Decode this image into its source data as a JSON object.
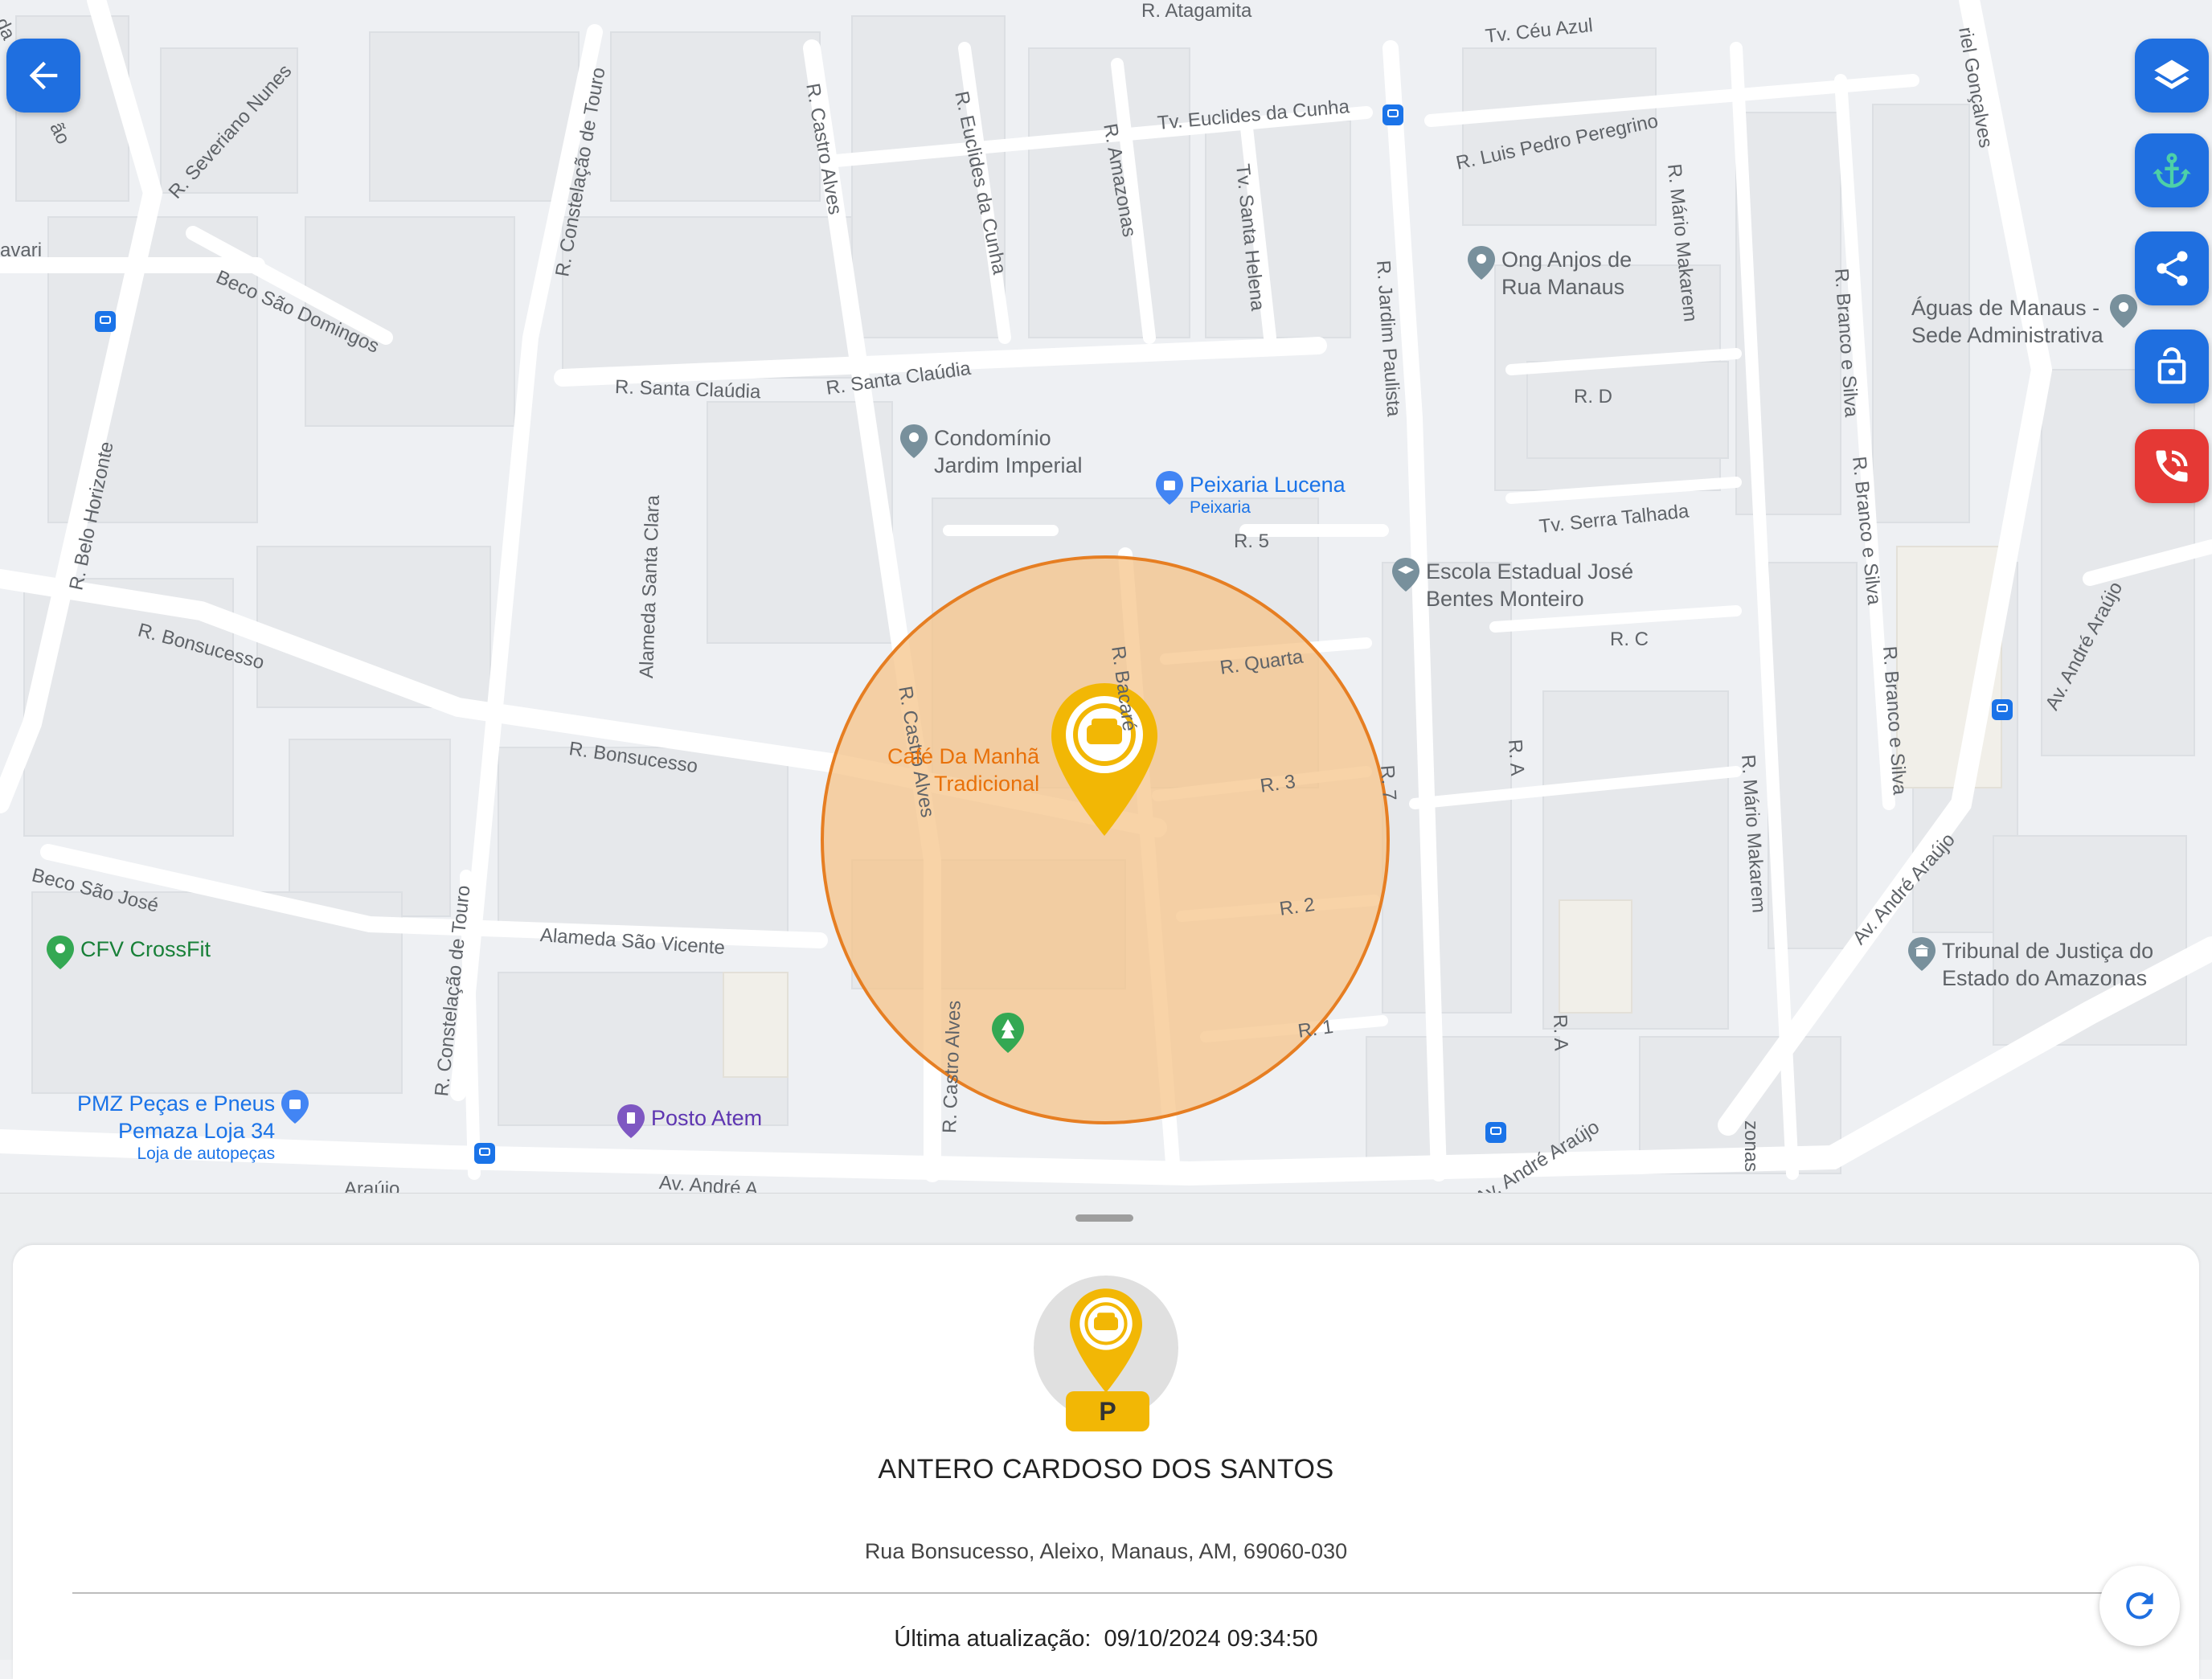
{
  "map": {
    "streets": [
      "R. Severiano Nunes",
      "R. Constelação de Touro",
      "R. Castro Alves",
      "R. Euclides da Cunha",
      "R. Amazonas",
      "Tv. Santa Helena",
      "R. Jardim Paulista",
      "R. Mário Makarem",
      "R. Branco e Silva",
      "Tv. Céu Azul",
      "Tv. Euclides da Cunha",
      "R. Luis Pedro Peregrino",
      "R. Atagamita",
      "Beco São Domingos",
      "R. Belo Horizonte",
      "R. Santa Claúdia",
      "R. Santa Claúdia",
      "Alameda Santa Clara",
      "R. Bonsucesso",
      "R. Bonsucesso",
      "Beco São José",
      "Alameda São Vicente",
      "R. 5",
      "Tv. Serra Talhada",
      "R. D",
      "R. C",
      "R. Quarta",
      "R. Bacaré",
      "R. 3",
      "R. 2",
      "R. 1",
      "R. 7",
      "R. A",
      "R. A",
      "Av. André Araújo",
      "Av. André Araújo",
      "Av. André Araújo",
      "Av. André Araújo",
      "Araújo",
      "Av. André A",
      "R. Castro Alves",
      "R. Castro Alves",
      "R. Constelação de Touro",
      "R. Mário Makarem",
      "R. Branco e Silva",
      "R. Branco e Silva",
      "zonas",
      "avari",
      "riel Gonçalves",
      "ão",
      "da"
    ],
    "pois": {
      "ong": "Ong Anjos de\nRua Manaus",
      "aguas": "Águas de Manaus -\nSede Administrativa",
      "condominio": "Condomínio\nJardim Imperial",
      "peixaria": "Peixaria Lucena",
      "peixaria_sub": "Peixaria",
      "escola": "Escola Estadual José\nBentes Monteiro",
      "cafe": "Café Da Manhã\nTradicional",
      "crossfit": "CFV CrossFit",
      "pmz": "PMZ Peças e Pneus\nPemaza Loja 34",
      "pmz_sub": "Loja de autopeças",
      "posto": "Posto Atem",
      "tribunal": "Tribunal de Justiça do\nEstado do Amazonas"
    },
    "geofence_color": "#f6c48a",
    "marker_color": "#f2b705"
  },
  "buttons": {
    "back": "arrow-left-icon",
    "layers": "layers-icon",
    "anchor": "anchor-icon",
    "share": "share-icon",
    "lock": "lock-open-icon",
    "call": "phone-call-icon",
    "refresh": "refresh-icon"
  },
  "vehicle": {
    "badge": "P",
    "name": "ANTERO CARDOSO DOS SANTOS",
    "address": "Rua Bonsucesso, Aleixo, Manaus, AM, 69060-030",
    "updated": "Última atualização:  09/10/2024 09:34:50"
  }
}
